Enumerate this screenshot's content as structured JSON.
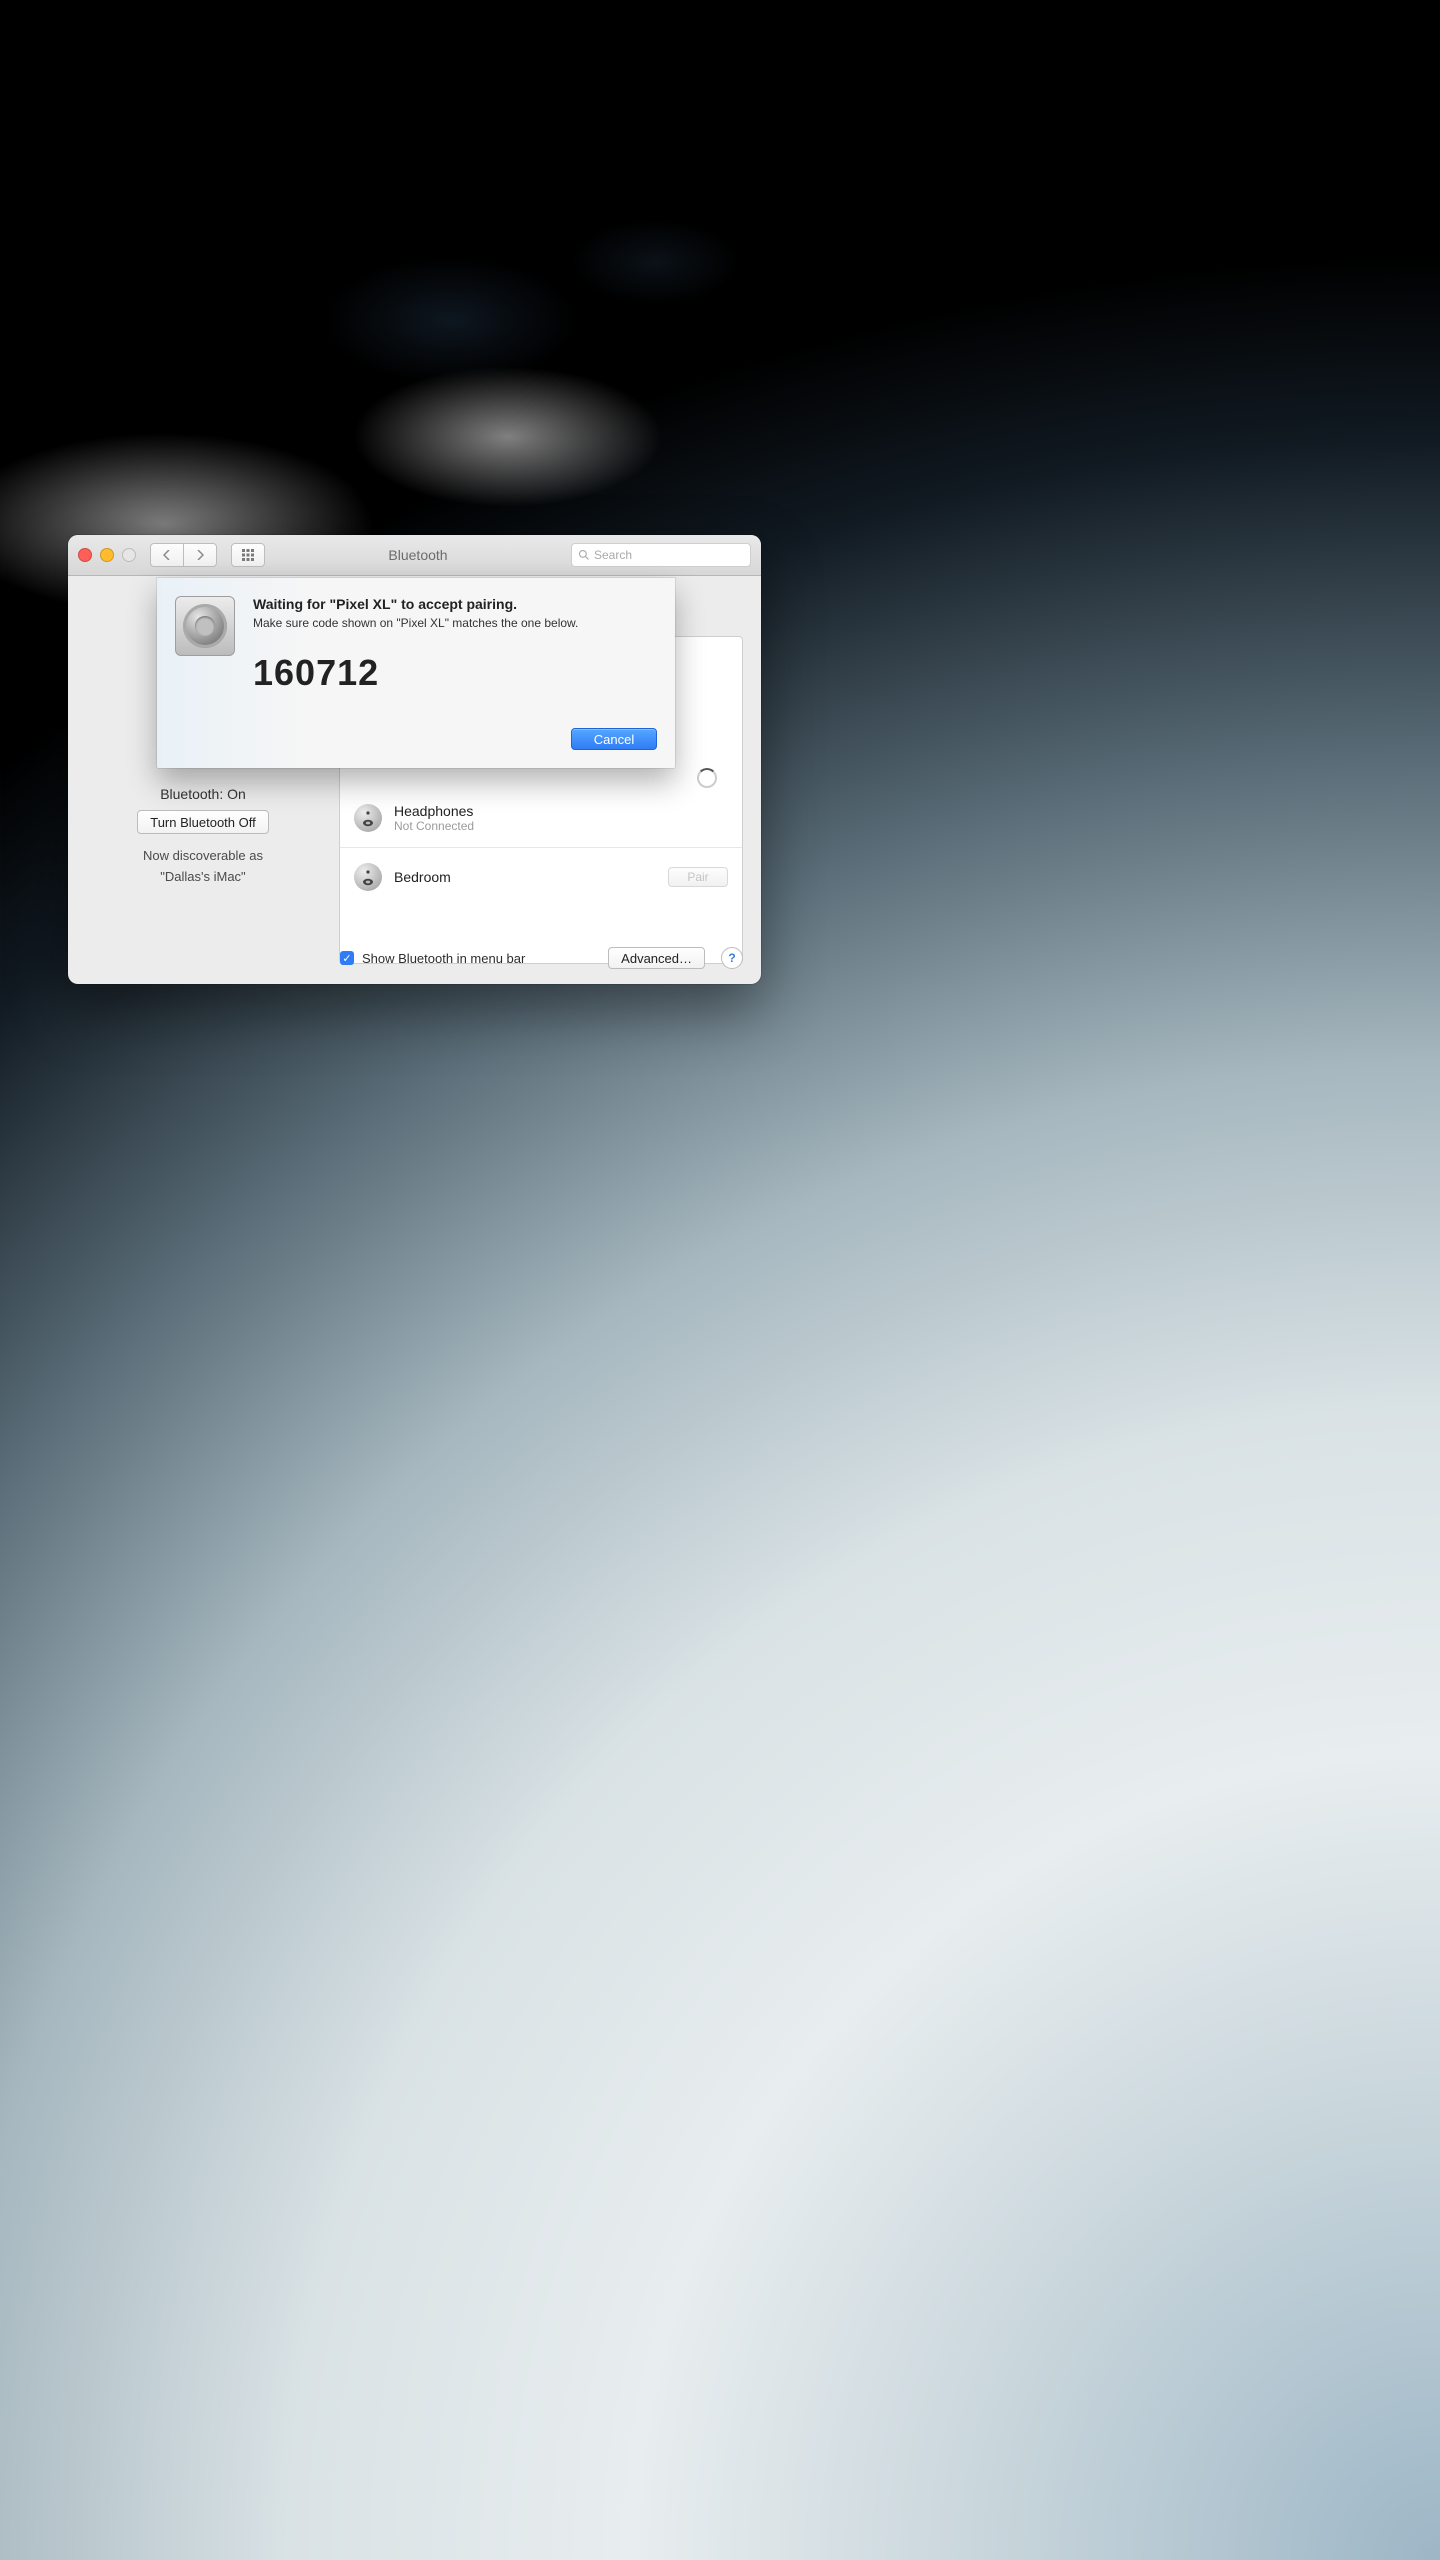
{
  "window": {
    "title": "Bluetooth",
    "search_placeholder": "Search"
  },
  "sidebar": {
    "status": "Bluetooth: On",
    "toggle_label": "Turn Bluetooth Off",
    "discoverable_line1": "Now discoverable as",
    "discoverable_line2": "\"Dallas's iMac\""
  },
  "devices": [
    {
      "name": "Headphones",
      "sub": "Not Connected",
      "icon": "speaker",
      "action": "spinner"
    },
    {
      "name": "Bedroom",
      "sub": "",
      "icon": "speaker",
      "action": "pair"
    }
  ],
  "bottom": {
    "show_menubar": "Show Bluetooth in menu bar",
    "advanced": "Advanced…",
    "pair_label": "Pair"
  },
  "sheet": {
    "title": "Waiting for \"Pixel XL\" to accept pairing.",
    "message": "Make sure code shown on \"Pixel XL\" matches the one below.",
    "code": "160712",
    "cancel": "Cancel"
  }
}
